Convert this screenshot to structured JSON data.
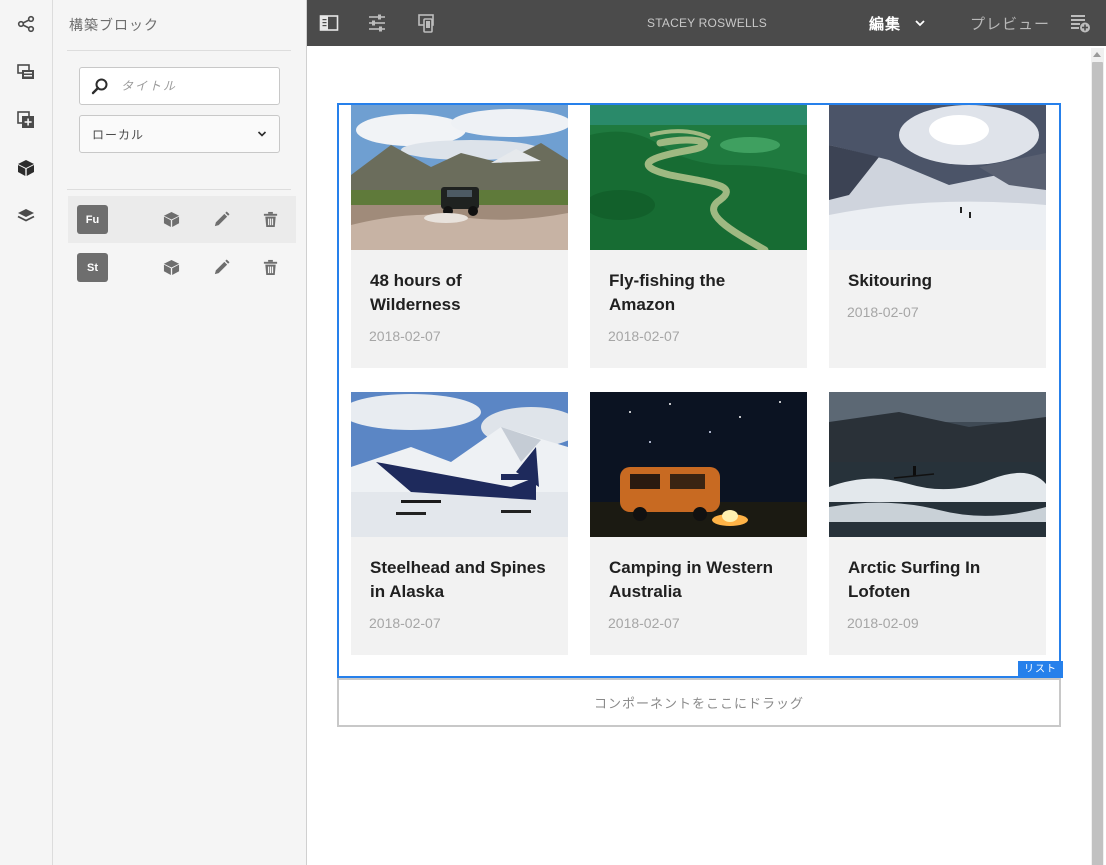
{
  "panel": {
    "title": "構築ブロック",
    "search_placeholder": "タイトル",
    "filter_value": "ローカル",
    "blocks": [
      {
        "badge": "Fu",
        "active": true
      },
      {
        "badge": "St",
        "active": false
      }
    ]
  },
  "toolbar": {
    "user": "STACEY ROSWELLS",
    "mode": "編集",
    "preview": "プレビュー"
  },
  "canvas": {
    "list_tag": "リスト",
    "drop_zone": "コンポーネントをここにドラッグ",
    "cards": [
      {
        "title": "48 hours of Wilderness",
        "date": "2018-02-07",
        "image": "jeep-river-mountains"
      },
      {
        "title": "Fly-fishing the Amazon",
        "date": "2018-02-07",
        "image": "amazon-river-aerial"
      },
      {
        "title": "Skitouring",
        "date": "2018-02-07",
        "image": "snowy-mountain-skiers"
      },
      {
        "title": "Steelhead and Spines in Alaska",
        "date": "2018-02-07",
        "image": "floatplane-on-snow"
      },
      {
        "title": "Camping in Western Australia",
        "date": "2018-02-07",
        "image": "van-campfire-night"
      },
      {
        "title": "Arctic Surfing In Lofoten",
        "date": "2018-02-09",
        "image": "surfer-dark-waves"
      }
    ]
  },
  "colors": {
    "accent": "#2680eb",
    "toolbar_bg": "#4b4b4b",
    "badge_bg": "#6e6e6e"
  }
}
